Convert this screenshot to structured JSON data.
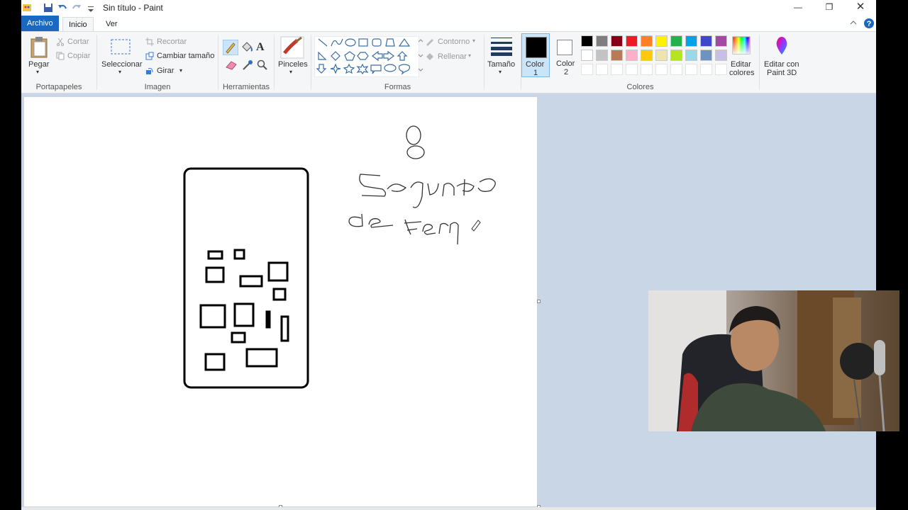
{
  "window": {
    "title": "Sin título - Paint"
  },
  "tabs": {
    "file": "Archivo",
    "home": "Inicio",
    "view": "Ver"
  },
  "clipboard": {
    "paste": "Pegar",
    "cut": "Cortar",
    "copy": "Copiar",
    "group": "Portapapeles"
  },
  "image": {
    "select": "Seleccionar",
    "crop": "Recortar",
    "resize": "Cambiar tamaño",
    "rotate": "Girar",
    "group": "Imagen"
  },
  "tools": {
    "group": "Herramientas"
  },
  "brushes": {
    "label": "Pinceles"
  },
  "shapes": {
    "outline": "Contorno",
    "fill": "Rellenar",
    "group": "Formas"
  },
  "size": {
    "label": "Tamaño"
  },
  "colors": {
    "color1": "Color",
    "color1_num": "1",
    "color2": "Color",
    "color2_num": "2",
    "edit": "Editar",
    "edit2": "colores",
    "group": "Colores",
    "row1": [
      "#000000",
      "#7f7f7f",
      "#880015",
      "#ed1c24",
      "#ff7f27",
      "#fff200",
      "#22b14c",
      "#00a2e8",
      "#3f48cc",
      "#a349a4"
    ],
    "row2": [
      "#ffffff",
      "#c3c3c3",
      "#b97a57",
      "#ffaec9",
      "#ffc90e",
      "#efe4b0",
      "#b5e61d",
      "#99d9ea",
      "#7092be",
      "#c8bfe7"
    ]
  },
  "paint3d": {
    "label1": "Editar con",
    "label2": "Paint 3D"
  }
}
